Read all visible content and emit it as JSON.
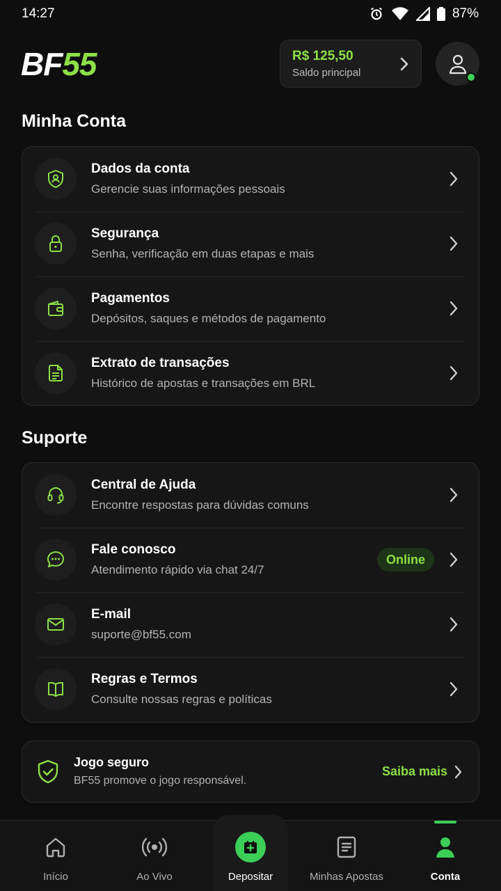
{
  "status_bar": {
    "time": "14:27",
    "battery": "87%"
  },
  "header": {
    "logo_bf": "BF",
    "logo_num": "55",
    "balance_amount": "R$ 125,50",
    "balance_label": "Saldo principal"
  },
  "account": {
    "title": "Minha Conta",
    "items": [
      {
        "icon": "shield-user-icon",
        "title": "Dados da conta",
        "subtitle": "Gerencie suas informações pessoais"
      },
      {
        "icon": "lock-icon",
        "title": "Segurança",
        "subtitle": "Senha, verificação em duas etapas e mais"
      },
      {
        "icon": "wallet-icon",
        "title": "Pagamentos",
        "subtitle": "Depósitos, saques e métodos de pagamento"
      },
      {
        "icon": "document-icon",
        "title": "Extrato de transações",
        "subtitle": "Histórico de apostas e transações em BRL"
      }
    ]
  },
  "support": {
    "title": "Suporte",
    "items": [
      {
        "icon": "headset-icon",
        "title": "Central de Ajuda",
        "subtitle": "Encontre respostas para dúvidas comuns"
      },
      {
        "icon": "chat-icon",
        "title": "Fale conosco",
        "subtitle": "Atendimento rápido via chat 24/7",
        "badge": "Online"
      },
      {
        "icon": "mail-icon",
        "title": "E-mail",
        "subtitle": "suporte@bf55.com"
      },
      {
        "icon": "book-icon",
        "title": "Regras e Termos",
        "subtitle": "Consulte nossas regras e políticas"
      }
    ]
  },
  "safe_game": {
    "title": "Jogo seguro",
    "subtitle": "BF55 promove o jogo responsável.",
    "link": "Saiba mais"
  },
  "bottom_nav": [
    {
      "icon": "home-icon",
      "label": "Início"
    },
    {
      "icon": "live-icon",
      "label": "Ao Vivo"
    },
    {
      "icon": "deposit-icon",
      "label": "Depositar"
    },
    {
      "icon": "bets-icon",
      "label": "Minhas Apostas"
    },
    {
      "icon": "user-icon",
      "label": "Conta",
      "active": true
    }
  ],
  "colors": {
    "accent": "#8be047",
    "accent_green": "#3ccf57",
    "background": "#0e0e0e",
    "card": "#161616"
  }
}
